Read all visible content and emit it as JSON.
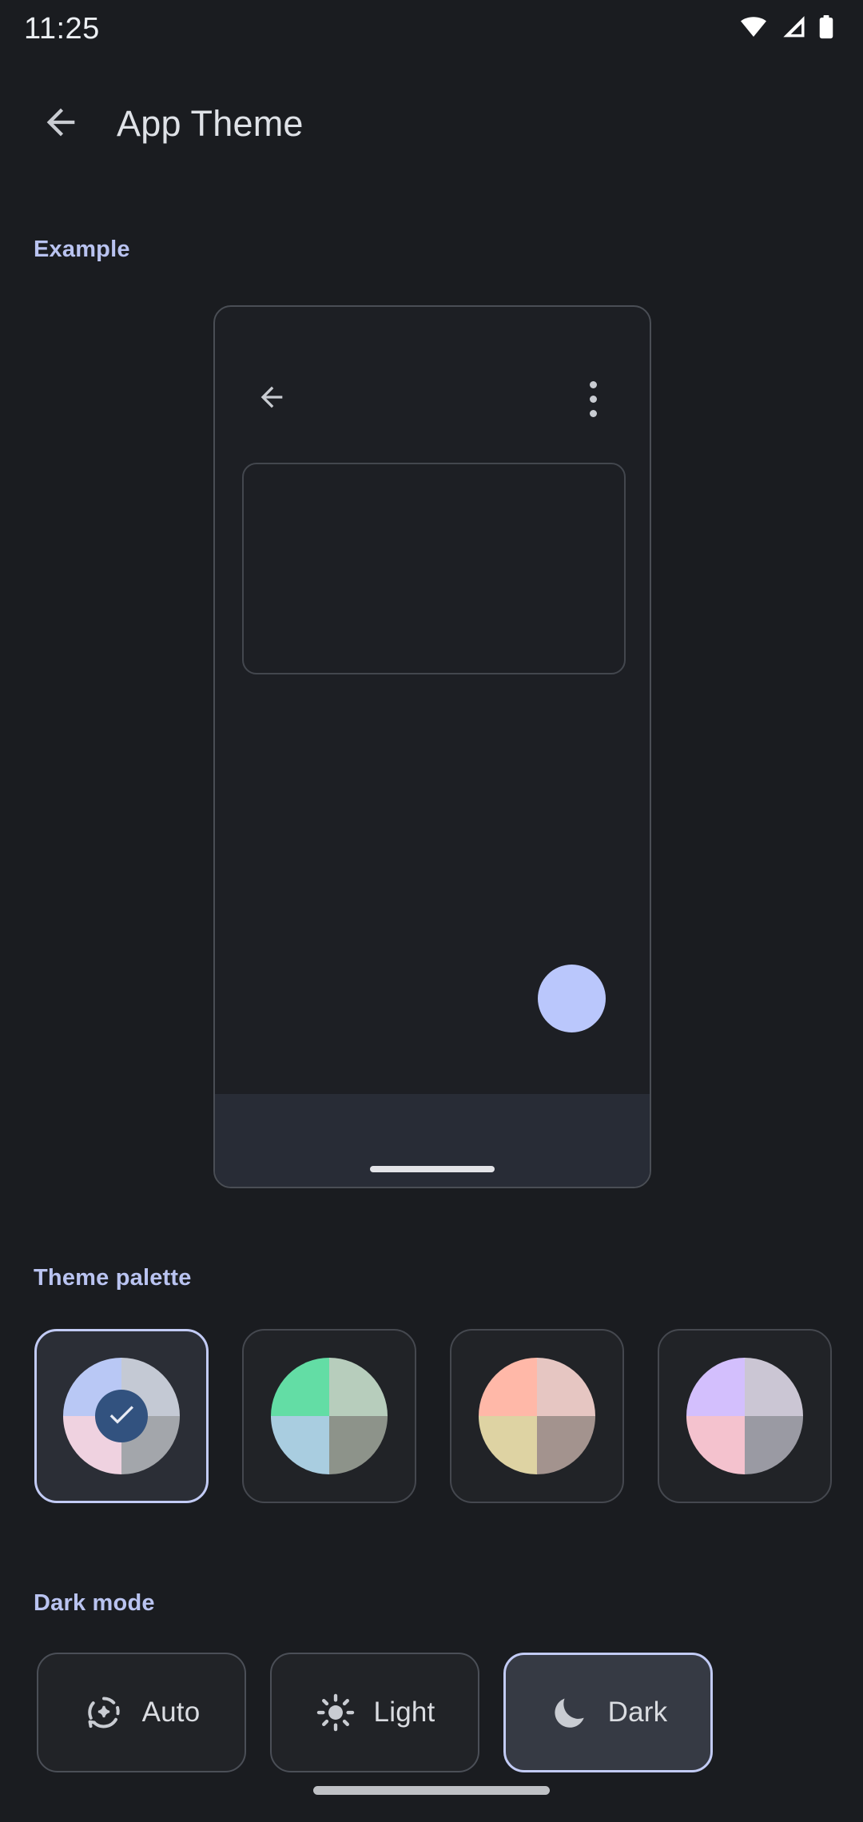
{
  "status_bar": {
    "time": "11:25",
    "icons": [
      "wifi-icon",
      "cellular-signal-icon",
      "battery-icon"
    ]
  },
  "app_bar": {
    "back_icon": "back-arrow-icon",
    "title": "App Theme"
  },
  "sections": {
    "example_label": "Example",
    "palette_label": "Theme palette",
    "dark_mode_label": "Dark mode"
  },
  "preview": {
    "back_icon": "back-arrow-icon",
    "overflow_icon": "more-vert-icon",
    "fab_color": "#bac7fc",
    "card_border_color": "#43474e",
    "frame_border_color": "#4a4e55",
    "navbar_color": "#282c36"
  },
  "palette": {
    "selected_index": 0,
    "selected_border_color": "#c2cbf5",
    "check_badge_color": "#32527f",
    "swatches": [
      {
        "name": "periwinkle-palette",
        "selected": true,
        "quadrants": {
          "top_left": "#b9c8f5",
          "top_right": "#c4c9d4",
          "bottom_left": "#efd2e0",
          "bottom_right": "#a3a6ab"
        }
      },
      {
        "name": "green-palette",
        "selected": false,
        "quadrants": {
          "top_left": "#63dda5",
          "top_right": "#b7cdbc",
          "bottom_left": "#a9cde0",
          "bottom_right": "#8d938a"
        }
      },
      {
        "name": "peach-palette",
        "selected": false,
        "quadrants": {
          "top_left": "#ffb8a8",
          "top_right": "#e6c6c2",
          "bottom_left": "#ded3a3",
          "bottom_right": "#a3938e"
        }
      },
      {
        "name": "lavender-palette",
        "selected": false,
        "quadrants": {
          "top_left": "#d3bffd",
          "top_right": "#cbc6d4",
          "bottom_left": "#f4c2ce",
          "bottom_right": "#9a9aa3"
        }
      }
    ]
  },
  "dark_mode": {
    "selected": "Dark",
    "options": [
      {
        "label": "Auto",
        "icon": "auto-mode-icon",
        "selected": false
      },
      {
        "label": "Light",
        "icon": "sun-icon",
        "selected": false
      },
      {
        "label": "Dark",
        "icon": "moon-icon",
        "selected": true
      }
    ]
  },
  "colors": {
    "background": "#1a1c20",
    "accent": "#b9c3f0",
    "text_primary": "#dfe2e7"
  }
}
